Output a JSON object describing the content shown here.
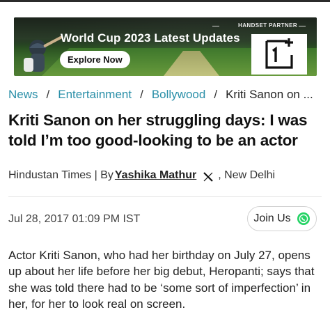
{
  "banner": {
    "title": "World Cup 2023 Latest Updates",
    "cta_label": "Explore Now",
    "partner_label": "HANDSET PARTNER",
    "partner_brand_icon": "oneplus-logo"
  },
  "breadcrumb": {
    "items": [
      "News",
      "Entertainment",
      "Bollywood"
    ],
    "separator": "/",
    "current": "Kriti Sanon on ..."
  },
  "article": {
    "headline": "Kriti Sanon on her struggling days: I was told I’m too good-looking to be an actor",
    "byline": {
      "publisher_prefix": "Hindustan Times | By",
      "author": "Yashika Mathur",
      "location": ", New Delhi",
      "social_icon": "x-icon"
    },
    "date": "Jul 28, 2017 01:09 PM IST",
    "join_label": "Join Us",
    "join_icon": "whatsapp-icon",
    "summary": "Actor Kriti Sanon, who had her birthday on July 27, opens up about her life before her big debut, Heropanti; says that she was told there had to be ‘some sort of imperfection’ in her, for her to look real on screen."
  },
  "colors": {
    "link": "#2a8fa8",
    "whatsapp": "#25d366",
    "text": "#1a1a1a"
  }
}
